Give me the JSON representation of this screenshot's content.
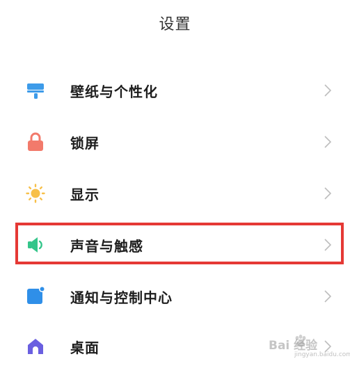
{
  "header": {
    "title": "设置"
  },
  "settings": [
    {
      "label": "壁纸与个性化",
      "icon": "wallpaper-brush-icon"
    },
    {
      "label": "锁屏",
      "icon": "lock-icon"
    },
    {
      "label": "显示",
      "icon": "brightness-sun-icon"
    },
    {
      "label": "声音与触感",
      "icon": "speaker-icon",
      "highlighted": true
    },
    {
      "label": "通知与控制中心",
      "icon": "notification-icon"
    },
    {
      "label": "桌面",
      "icon": "home-icon"
    }
  ],
  "colors": {
    "wallpaper": "#3d9be9",
    "lock": "#f27a6b",
    "sun": "#f7c04a",
    "speaker": "#34c58a",
    "notification": "#2f8fe8",
    "home": "#6a5fe0",
    "highlight": "#e53935",
    "chevron": "#bdbdbd"
  },
  "watermark": {
    "text": "Bai 经验",
    "subtext": "jingyan.baidu.com"
  }
}
